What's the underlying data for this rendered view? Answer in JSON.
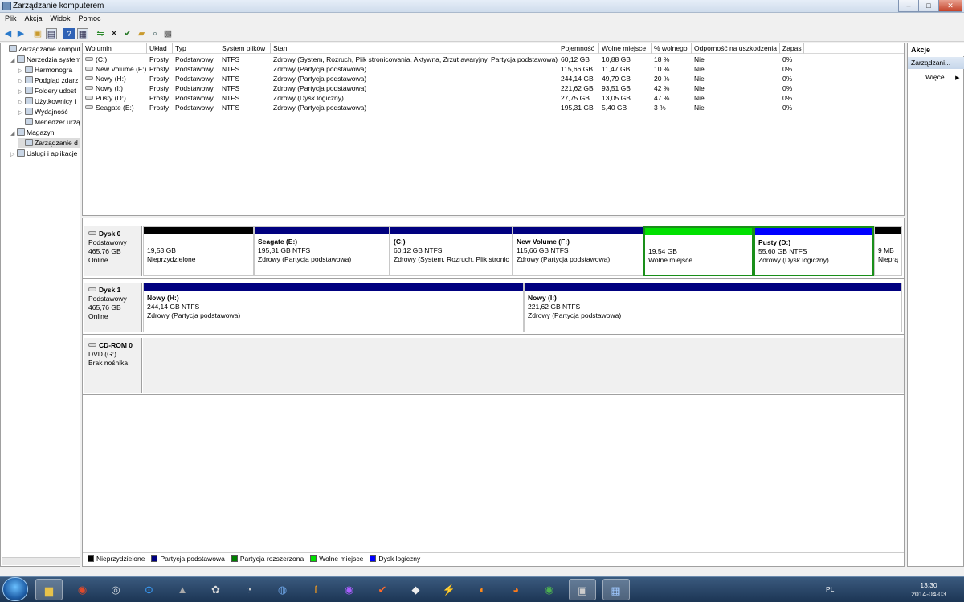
{
  "window": {
    "title": "Zarządzanie komputerem",
    "min": "–",
    "max": "□",
    "close": "✕"
  },
  "menu": [
    "Plik",
    "Akcja",
    "Widok",
    "Pomoc"
  ],
  "toolbar_icons": [
    "back-arrow-icon",
    "forward-arrow-icon",
    "up-folder-icon",
    "show-tree-icon",
    "help-icon",
    "properties-icon",
    "connect-icon",
    "delete-icon",
    "check-icon",
    "open-folder-icon",
    "search-icon",
    "refresh-icon"
  ],
  "tree": [
    {
      "label": "Zarządzanie kompute",
      "indent": 0,
      "expander": "",
      "icon": "computer-management-icon"
    },
    {
      "label": "Narzędzia system",
      "indent": 1,
      "expander": "◢",
      "icon": "tools-icon"
    },
    {
      "label": "Harmonogra",
      "indent": 2,
      "expander": "▷",
      "icon": "clock-icon"
    },
    {
      "label": "Podgląd zdarz",
      "indent": 2,
      "expander": "▷",
      "icon": "event-viewer-icon"
    },
    {
      "label": "Foldery udost",
      "indent": 2,
      "expander": "▷",
      "icon": "shared-folder-icon"
    },
    {
      "label": "Użytkownicy i",
      "indent": 2,
      "expander": "▷",
      "icon": "users-icon"
    },
    {
      "label": "Wydajność",
      "indent": 2,
      "expander": "▷",
      "icon": "performance-icon"
    },
    {
      "label": "Menedżer urzą",
      "indent": 2,
      "expander": "",
      "icon": "device-manager-icon"
    },
    {
      "label": "Magazyn",
      "indent": 1,
      "expander": "◢",
      "icon": "storage-icon"
    },
    {
      "label": "Zarządzanie d",
      "indent": 2,
      "expander": "",
      "icon": "disk-management-icon",
      "selected": true
    },
    {
      "label": "Usługi i aplikacje",
      "indent": 1,
      "expander": "▷",
      "icon": "services-icon"
    }
  ],
  "volume_columns": [
    "Wolumin",
    "Układ",
    "Typ",
    "System plików",
    "Stan",
    "Pojemność",
    "Wolne miejsce",
    "% wolnego",
    "Odporność na uszkodzenia",
    "Zapas"
  ],
  "volumes": [
    [
      "(C:)",
      "Prosty",
      "Podstawowy",
      "NTFS",
      "Zdrowy (System, Rozruch, Plik stronicowania, Aktywna, Zrzut awaryjny, Partycja podstawowa)",
      "60,12 GB",
      "10,88 GB",
      "18 %",
      "Nie",
      "0%"
    ],
    [
      "New Volume (F:)",
      "Prosty",
      "Podstawowy",
      "NTFS",
      "Zdrowy (Partycja podstawowa)",
      "115,66 GB",
      "11,47 GB",
      "10 %",
      "Nie",
      "0%"
    ],
    [
      "Nowy (H:)",
      "Prosty",
      "Podstawowy",
      "NTFS",
      "Zdrowy (Partycja podstawowa)",
      "244,14 GB",
      "49,79 GB",
      "20 %",
      "Nie",
      "0%"
    ],
    [
      "Nowy (I:)",
      "Prosty",
      "Podstawowy",
      "NTFS",
      "Zdrowy (Partycja podstawowa)",
      "221,62 GB",
      "93,51 GB",
      "42 %",
      "Nie",
      "0%"
    ],
    [
      "Pusty (D:)",
      "Prosty",
      "Podstawowy",
      "NTFS",
      "Zdrowy (Dysk logiczny)",
      "27,75 GB",
      "13,05 GB",
      "47 %",
      "Nie",
      "0%"
    ],
    [
      "Seagate (E:)",
      "Prosty",
      "Podstawowy",
      "NTFS",
      "Zdrowy (Partycja podstawowa)",
      "195,31 GB",
      "5,40 GB",
      "3 %",
      "Nie",
      "0%"
    ]
  ],
  "disks": [
    {
      "name": "Dysk 0",
      "type": "Podstawowy",
      "size": "465,76 GB",
      "status": "Online",
      "partitions": [
        {
          "title": "",
          "line1": "19,53 GB",
          "line2": "Nieprzydzielone",
          "bar": "#000000"
        },
        {
          "title": "Seagate  (E:)",
          "line1": "195,31 GB NTFS",
          "line2": "Zdrowy (Partycja podstawowa)",
          "bar": "#00007f"
        },
        {
          "title": "(C:)",
          "line1": "60,12 GB NTFS",
          "line2": "Zdrowy (System, Rozruch, Plik stronic",
          "bar": "#00007f"
        },
        {
          "title": "New Volume  (F:)",
          "line1": "115,66 GB NTFS",
          "line2": "Zdrowy (Partycja podstawowa)",
          "bar": "#00007f"
        },
        {
          "title": "",
          "line1": "19,54 GB",
          "line2": "Wolne miejsce",
          "bar": "#00e000"
        },
        {
          "title": "Pusty  (D:)",
          "line1": "55,60 GB NTFS",
          "line2": "Zdrowy (Dysk logiczny)",
          "bar": "#0000ff"
        },
        {
          "title": "",
          "line1": "9 MB",
          "line2": "Nieprą",
          "bar": "#000000"
        }
      ]
    },
    {
      "name": "Dysk 1",
      "type": "Podstawowy",
      "size": "465,76 GB",
      "status": "Online",
      "partitions": [
        {
          "title": "Nowy  (H:)",
          "line1": "244,14 GB NTFS",
          "line2": "Zdrowy (Partycja podstawowa)",
          "bar": "#00007f"
        },
        {
          "title": "Nowy  (I:)",
          "line1": "221,62 GB NTFS",
          "line2": "Zdrowy (Partycja podstawowa)",
          "bar": "#00007f"
        }
      ]
    },
    {
      "name": "CD-ROM 0",
      "type": "DVD (G:)",
      "size": "",
      "status": "Brak nośnika",
      "partitions": []
    }
  ],
  "legend": [
    {
      "label": "Nieprzydzielone",
      "color": "#000000"
    },
    {
      "label": "Partycja podstawowa",
      "color": "#00007f"
    },
    {
      "label": "Partycja rozszerzona",
      "color": "#008000"
    },
    {
      "label": "Wolne miejsce",
      "color": "#00e000"
    },
    {
      "label": "Dysk logiczny",
      "color": "#0000ff"
    }
  ],
  "actions": {
    "header": "Akcje",
    "section": "Zarządzani...",
    "more": "Więce..."
  },
  "taskbar": {
    "apps": [
      "explorer-icon",
      "opera-icon",
      "steam-icon",
      "uplay-icon",
      "games-icon",
      "tool-icon",
      "messenger-icon",
      "chrome-like-icon",
      "fl-studio-icon",
      "cd-icon",
      "checkmark-app-icon",
      "fox-icon",
      "winamp-icon",
      "origin-icon",
      "firefox-icon",
      "chrome-icon",
      "computer-management-icon",
      "network-icon"
    ],
    "lang": "PL",
    "time": "13:30",
    "date": "2014-04-03"
  }
}
